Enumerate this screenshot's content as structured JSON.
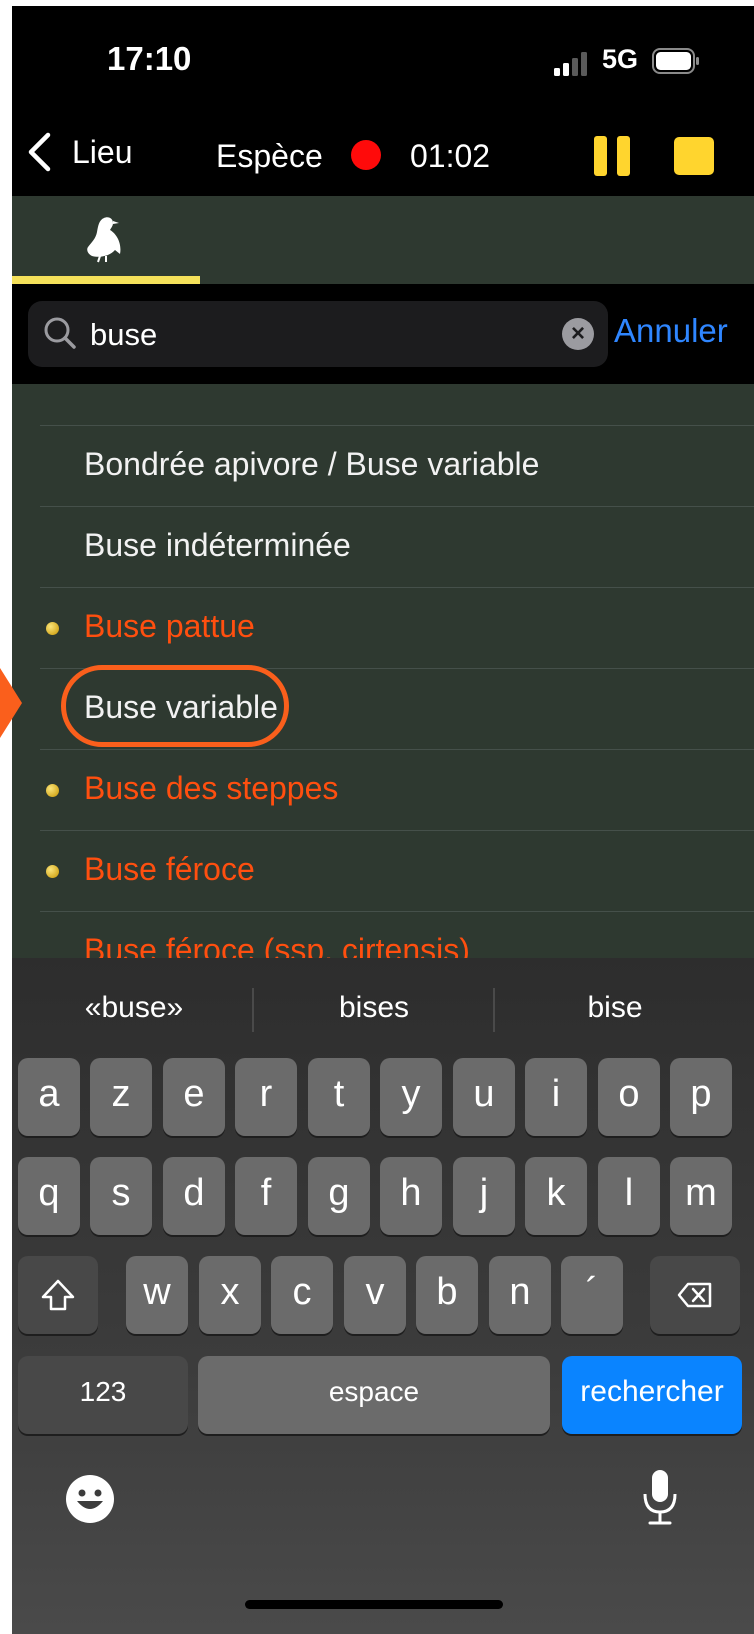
{
  "status_bar": {
    "time": "17:10",
    "network": "5G"
  },
  "nav": {
    "back_label": "Lieu",
    "title": "Espèce",
    "timer": "01:02"
  },
  "search": {
    "value": "buse",
    "cancel_label": "Annuler"
  },
  "results": [
    {
      "name": "Bondrée apivore / Buse variable",
      "highlighted_species": false,
      "dot": false
    },
    {
      "name": "Buse indéterminée",
      "highlighted_species": false,
      "dot": false
    },
    {
      "name": "Buse pattue",
      "highlighted_species": true,
      "dot": true
    },
    {
      "name": "Buse variable",
      "highlighted_species": false,
      "dot": false,
      "circled": true
    },
    {
      "name": "Buse des steppes",
      "highlighted_species": true,
      "dot": true
    },
    {
      "name": "Buse féroce",
      "highlighted_species": true,
      "dot": true
    },
    {
      "name": "Buse féroce (ssp. cirtensis)",
      "highlighted_species": true,
      "dot": false
    }
  ],
  "keyboard": {
    "suggestions": [
      "«buse»",
      "bises",
      "bise"
    ],
    "row1": [
      "a",
      "z",
      "e",
      "r",
      "t",
      "y",
      "u",
      "i",
      "o",
      "p"
    ],
    "row2": [
      "q",
      "s",
      "d",
      "f",
      "g",
      "h",
      "j",
      "k",
      "l",
      "m"
    ],
    "row3": [
      "w",
      "x",
      "c",
      "v",
      "b",
      "n",
      "´"
    ],
    "numbers_label": "123",
    "space_label": "espace",
    "search_label": "rechercher"
  },
  "colors": {
    "accent_yellow": "#ffd52e",
    "record_red": "#ff0a0a",
    "link_blue": "#2f86ff",
    "warning_orange": "#ff4f0f",
    "list_bg": "#2e3930"
  }
}
